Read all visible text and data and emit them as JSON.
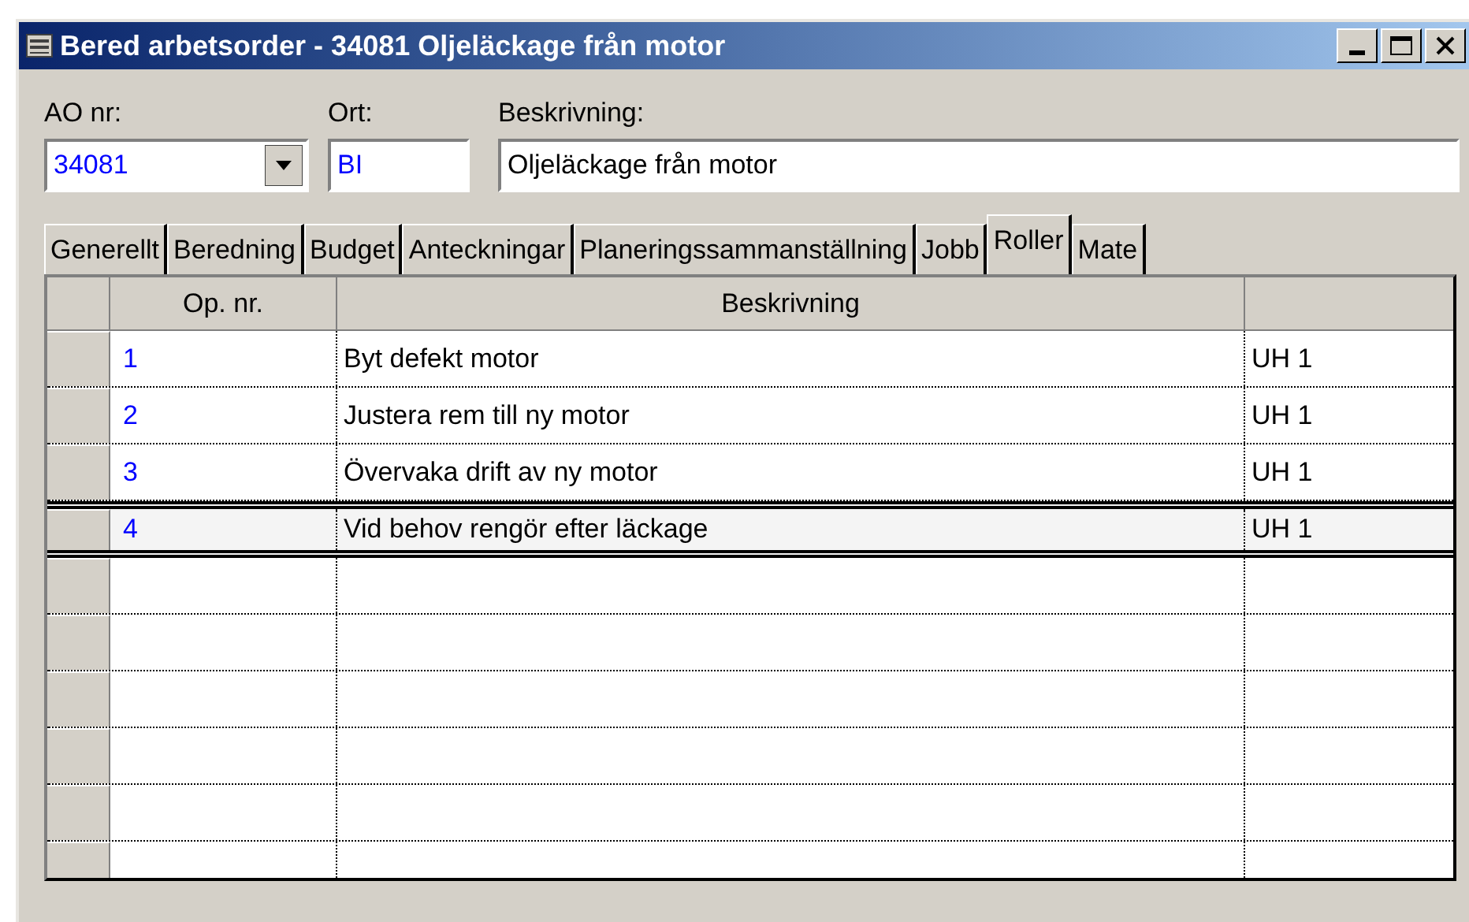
{
  "window": {
    "title": "Bered arbetsorder - 34081 Oljeläckage från motor"
  },
  "fields": {
    "ao_nr": {
      "label": "AO nr:",
      "value": "34081"
    },
    "ort": {
      "label": "Ort:",
      "value": "BI"
    },
    "beskrivning": {
      "label": "Beskrivning:",
      "value": "Oljeläckage från motor"
    }
  },
  "tabs": [
    {
      "label": "Generellt",
      "selected": false
    },
    {
      "label": "Beredning",
      "selected": false
    },
    {
      "label": "Budget",
      "selected": false
    },
    {
      "label": "Anteckningar",
      "selected": false
    },
    {
      "label": "Planeringssammanställning",
      "selected": false
    },
    {
      "label": "Jobb",
      "selected": false
    },
    {
      "label": "Roller",
      "selected": true
    },
    {
      "label": "Mate",
      "selected": false
    }
  ],
  "table": {
    "columns": [
      "Op. nr.",
      "Beskrivning"
    ],
    "rows": [
      {
        "op_nr": "1",
        "beskrivning": "Byt defekt motor",
        "column_3": "UH 1",
        "selected": false
      },
      {
        "op_nr": "2",
        "beskrivning": "Justera rem till ny motor",
        "column_3": "UH 1",
        "selected": false
      },
      {
        "op_nr": "3",
        "beskrivning": "Övervaka drift av ny motor",
        "column_3": "UH 1",
        "selected": false
      },
      {
        "op_nr": "4",
        "beskrivning": "Vid behov rengör efter läckage",
        "column_3": "UH 1",
        "selected": true
      }
    ]
  }
}
